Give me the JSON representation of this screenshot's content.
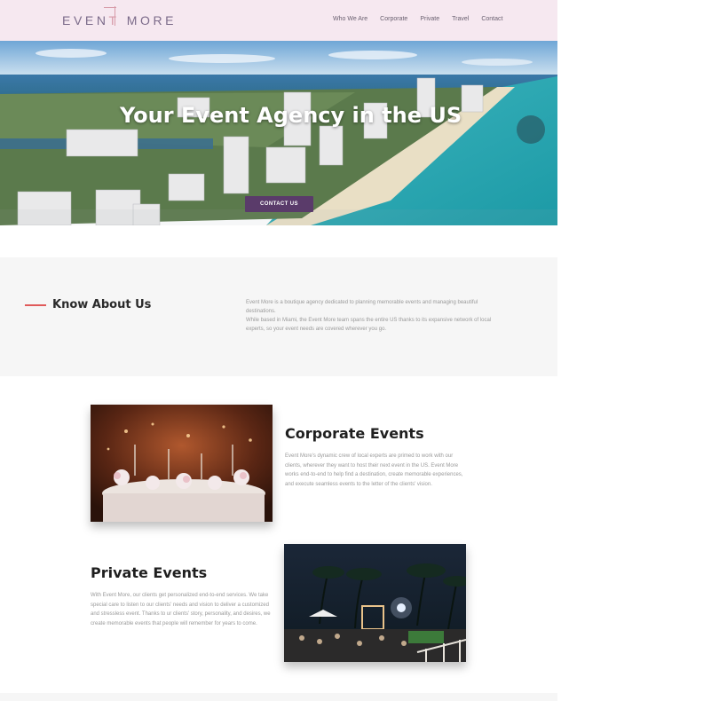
{
  "brand": {
    "logo_text_left": "EVEN",
    "logo_text_mid": "T",
    "logo_text_right": "MORE"
  },
  "nav": {
    "items": [
      "Who We Are",
      "Corporate",
      "Private",
      "Travel",
      "Contact"
    ]
  },
  "hero": {
    "title": "Your Event Agency in the US",
    "button_label": "CONTACT US"
  },
  "about": {
    "heading": "Know About Us",
    "paragraph_1": "Event More is a boutique agency dedicated to planning memorable events and managing beautiful destinations.",
    "paragraph_2": "While based in Miami, the Event More team spans the entire US thanks to its expansive network of local experts, so your event needs are covered wherever you go."
  },
  "corporate": {
    "title": "Corporate Events",
    "text": "Event More's dynamic crew of local experts are primed to work with our clients, wherever they want to host their next event in the US. Event More works end-to-end to help find a destination, create memorable experiences, and execute seamless events to the letter of the clients' vision."
  },
  "private": {
    "title": "Private Events",
    "text": "With Event More, our clients get personalized end-to-end services. We take special care to listen to our clients' needs and vision to deliver a customized and stressless event. Thanks to ur clients' story, personality, and desires, we create memorable events that people will remember for years to come."
  },
  "colors": {
    "header_bg": "#f6e8f0",
    "accent_button": "#5a3b6a",
    "accent_line": "#e05a5a",
    "section_bg": "#f6f6f6"
  }
}
